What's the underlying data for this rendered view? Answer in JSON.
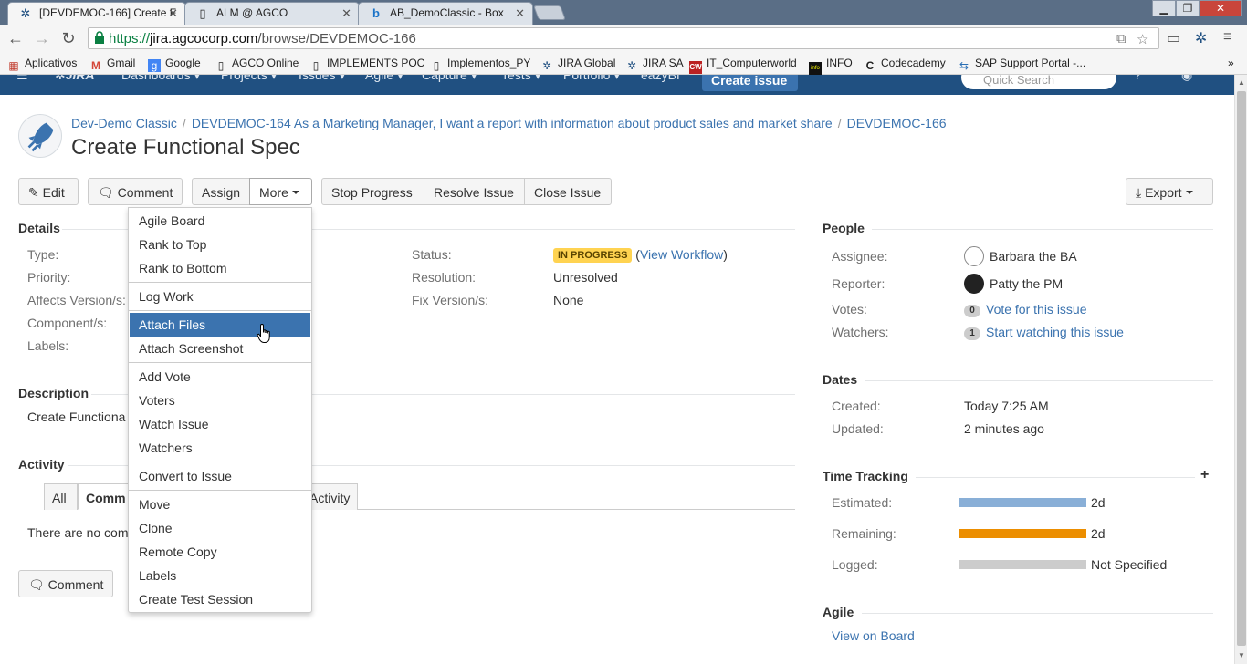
{
  "browser": {
    "tabs": [
      {
        "title": "[DEVDEMOC-166] Create F",
        "active": true
      },
      {
        "title": "ALM @ AGCO",
        "active": false
      },
      {
        "title": "AB_DemoClassic - Box",
        "active": false
      }
    ],
    "url_scheme": "https://",
    "url_host": "jira.agcocorp.com",
    "url_path": "/browse/DEVDEMOC-166",
    "bookmarks": [
      "Aplicativos",
      "Gmail",
      "Google",
      "AGCO Online",
      "IMPLEMENTS POC",
      "Implementos_PY",
      "JIRA Global",
      "JIRA SA",
      "IT_Computerworld",
      "INFO",
      "Codecademy",
      "SAP Support Portal -..."
    ],
    "bookmarks_more": "»"
  },
  "jira_nav": {
    "items": [
      "Dashboards ▾",
      "Projects ▾",
      "Issues ▾",
      "Agile ▾",
      "Capture ▾",
      "Tests ▾",
      "Portfolio ▾",
      "eazyBI"
    ],
    "create": "Create issue",
    "search_placeholder": "Quick Search"
  },
  "issue": {
    "breadcrumbs": [
      "Dev-Demo Classic",
      "DEVDEMOC-164 As a Marketing Manager, I want a report with information about product sales and market share",
      "DEVDEMOC-166"
    ],
    "summary": "Create Functional Spec"
  },
  "actions": {
    "edit": "Edit",
    "comment": "Comment",
    "assign": "Assign",
    "more": "More",
    "stop_progress": "Stop Progress",
    "resolve": "Resolve Issue",
    "close": "Close Issue",
    "export": "Export"
  },
  "details": {
    "title": "Details",
    "labels": [
      "Type:",
      "Priority:",
      "Affects Version/s:",
      "Component/s:",
      "Labels:"
    ],
    "status_label": "Status:",
    "status_value": "IN PROGRESS",
    "view_workflow": "View Workflow",
    "resolution_label": "Resolution:",
    "resolution_value": "Unresolved",
    "fix_label": "Fix Version/s:",
    "fix_value": "None"
  },
  "description": {
    "title": "Description",
    "text": "Create Functiona"
  },
  "activity": {
    "title": "Activity",
    "tabs": [
      "All",
      "Comm",
      "Activity"
    ],
    "empty": "There are no com",
    "comment_button": "Comment"
  },
  "people": {
    "title": "People",
    "assignee_label": "Assignee:",
    "assignee": "Barbara the BA",
    "reporter_label": "Reporter:",
    "reporter": "Patty the PM",
    "votes_label": "Votes:",
    "votes_count": "0",
    "vote_link": "Vote for this issue",
    "watchers_label": "Watchers:",
    "watchers_count": "1",
    "watch_link": "Start watching this issue"
  },
  "dates": {
    "title": "Dates",
    "created_label": "Created:",
    "created": "Today 7:25 AM",
    "updated_label": "Updated:",
    "updated": "2 minutes ago"
  },
  "time_tracking": {
    "title": "Time Tracking",
    "plus": "+",
    "estimated_label": "Estimated:",
    "estimated": "2d",
    "estimated_fill": 1.0,
    "remaining_label": "Remaining:",
    "remaining": "2d",
    "remaining_fill": 1.0,
    "logged_label": "Logged:",
    "logged": "Not Specified",
    "logged_fill": 0.0,
    "colors": {
      "estimated": "#89afd7",
      "remaining": "#ec8e00",
      "logged": "#cccccc"
    }
  },
  "agile": {
    "title": "Agile",
    "view_on_board": "View on Board"
  },
  "more_menu": {
    "groups": [
      [
        "Agile Board",
        "Rank to Top",
        "Rank to Bottom"
      ],
      [
        "Log Work"
      ],
      [
        "Attach Files",
        "Attach Screenshot"
      ],
      [
        "Add Vote",
        "Voters",
        "Watch Issue",
        "Watchers"
      ],
      [
        "Convert to Issue"
      ],
      [
        "Move",
        "Clone",
        "Remote Copy",
        "Labels",
        "Create Test Session"
      ]
    ],
    "highlighted": "Attach Files"
  }
}
